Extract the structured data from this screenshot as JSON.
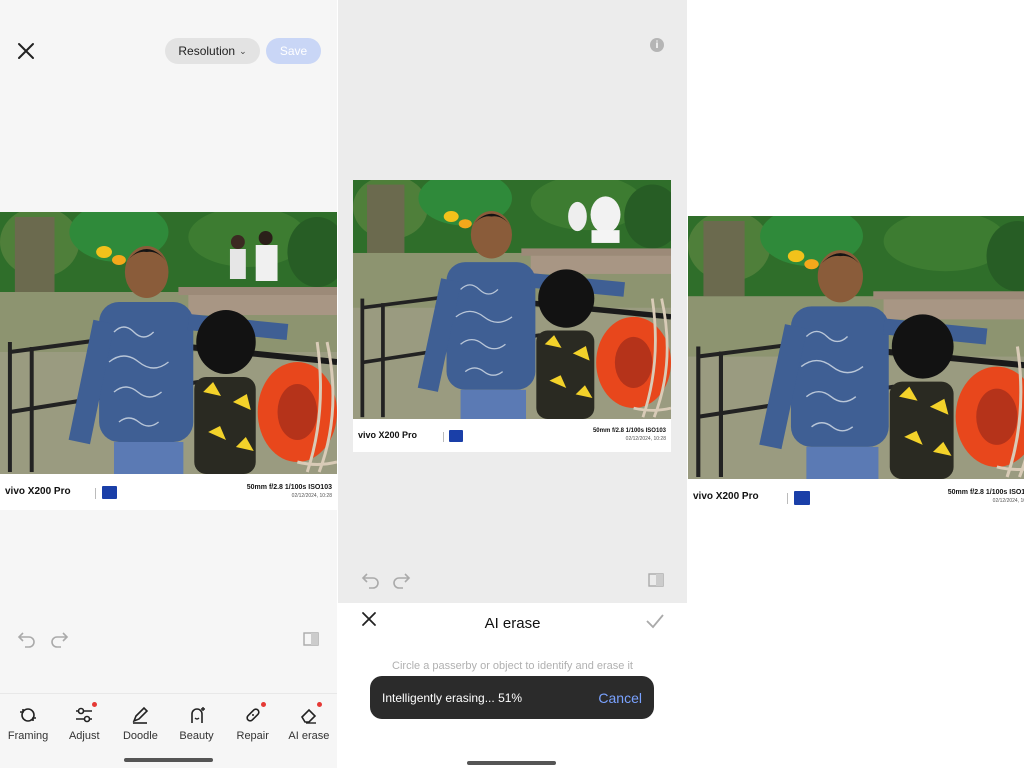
{
  "editor": {
    "resolution_label": "Resolution",
    "save_label": "Save",
    "tools": [
      {
        "label": "Framing",
        "icon": "framing-icon",
        "badge": false
      },
      {
        "label": "Adjust",
        "icon": "adjust-icon",
        "badge": true
      },
      {
        "label": "Doodle",
        "icon": "doodle-icon",
        "badge": false
      },
      {
        "label": "Beauty",
        "icon": "beauty-icon",
        "badge": false
      },
      {
        "label": "Repair",
        "icon": "repair-icon",
        "badge": true
      },
      {
        "label": "AI erase",
        "icon": "ai-erase-icon",
        "badge": true
      }
    ]
  },
  "ai_erase": {
    "title": "AI erase",
    "hint": "Circle a passerby or object to identify and erase it",
    "toast_text": "Intelligently erasing... 51%",
    "progress_percent": 51,
    "cancel_label": "Cancel"
  },
  "watermark": {
    "brand": "vivo X200 Pro",
    "specs": "50mm  f/2.8  1/100s  ISO103",
    "date": "02/12/2024, 10:28"
  },
  "colors": {
    "accent": "#5b8cff",
    "save_disabled": "#c9d6f6",
    "badge": "#e53935",
    "zeiss_blue": "#1a3fa8"
  }
}
